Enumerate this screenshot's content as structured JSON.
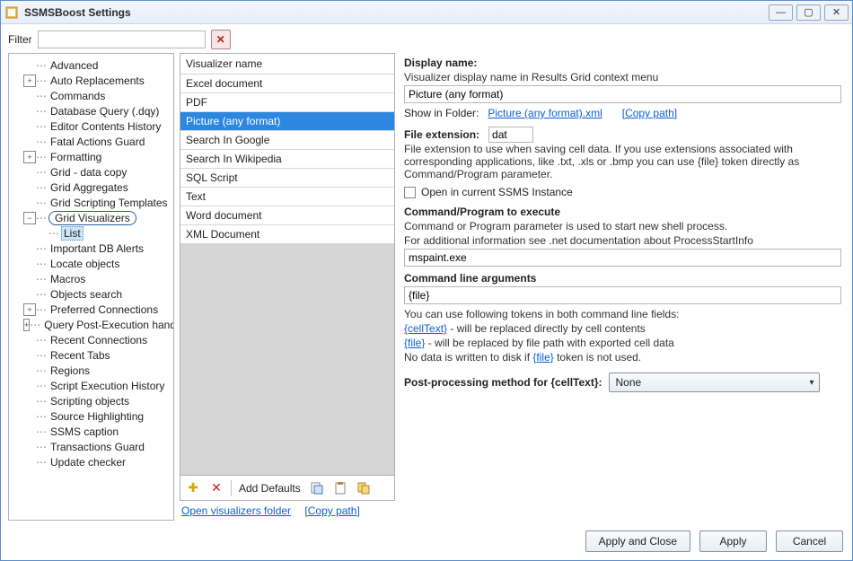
{
  "window": {
    "title": "SSMSBoost Settings"
  },
  "filter": {
    "label": "Filter",
    "value": ""
  },
  "tree": {
    "items": [
      {
        "label": "Advanced",
        "indent": 1
      },
      {
        "label": "Auto Replacements",
        "indent": 1,
        "expand": "plus"
      },
      {
        "label": "Commands",
        "indent": 1
      },
      {
        "label": "Database Query (.dqy)",
        "indent": 1
      },
      {
        "label": "Editor Contents History",
        "indent": 1
      },
      {
        "label": "Fatal Actions Guard",
        "indent": 1
      },
      {
        "label": "Formatting",
        "indent": 1,
        "expand": "plus"
      },
      {
        "label": "Grid - data copy",
        "indent": 1
      },
      {
        "label": "Grid Aggregates",
        "indent": 1
      },
      {
        "label": "Grid Scripting Templates",
        "indent": 1
      },
      {
        "label": "Grid Visualizers",
        "indent": 1,
        "expand": "minus",
        "ring": true
      },
      {
        "label": "List",
        "indent": 2,
        "selected": true
      },
      {
        "label": "Important DB Alerts",
        "indent": 1
      },
      {
        "label": "Locate objects",
        "indent": 1
      },
      {
        "label": "Macros",
        "indent": 1
      },
      {
        "label": "Objects search",
        "indent": 1
      },
      {
        "label": "Preferred Connections",
        "indent": 1,
        "expand": "plus"
      },
      {
        "label": "Query Post-Execution handlers",
        "indent": 1,
        "expand": "plus"
      },
      {
        "label": "Recent Connections",
        "indent": 1
      },
      {
        "label": "Recent Tabs",
        "indent": 1
      },
      {
        "label": "Regions",
        "indent": 1
      },
      {
        "label": "Script Execution History",
        "indent": 1
      },
      {
        "label": "Scripting objects",
        "indent": 1
      },
      {
        "label": "Source Highlighting",
        "indent": 1
      },
      {
        "label": "SSMS caption",
        "indent": 1
      },
      {
        "label": "Transactions Guard",
        "indent": 1
      },
      {
        "label": "Update checker",
        "indent": 1
      }
    ]
  },
  "list": {
    "header": "Visualizer name",
    "items": [
      "Excel document",
      "PDF",
      "Picture (any format)",
      "Search In Google",
      "Search In Wikipedia",
      "SQL Script",
      "Text",
      "Word document",
      "XML Document"
    ],
    "selected_index": 2,
    "toolbar": {
      "add": "add-icon",
      "remove": "remove-icon",
      "defaults_label": "Add Defaults",
      "copy": "copy-icon",
      "paste": "paste-icon",
      "duplicate": "duplicate-icon"
    },
    "links": {
      "open_folder": "Open visualizers folder",
      "copy_path": "[Copy path]"
    }
  },
  "detail": {
    "display_name": {
      "title": "Display name:",
      "desc": "Visualizer display name in Results Grid context menu",
      "value": "Picture (any format)",
      "show_in_label": "Show in Folder:",
      "show_in_link": "Picture (any format).xml",
      "copy_path": "[Copy path]"
    },
    "file_ext": {
      "title": "File extension:",
      "value": "dat",
      "desc": "File extension to use when saving cell data. If you use extensions associated with corresponding applications, like .txt, .xls or .bmp you can use {file} token directly as Command/Program parameter."
    },
    "open_ssms": {
      "label": "Open in current SSMS Instance",
      "checked": false
    },
    "command": {
      "title": "Command/Program to execute",
      "desc1": "Command or Program parameter is used to start new shell process.",
      "desc2": "For additional information see .net documentation about ProcessStartInfo",
      "value": "mspaint.exe"
    },
    "args": {
      "title": "Command line arguments",
      "value": "{file}",
      "tokens_intro": "You can use following tokens in both command line fields:",
      "tok1": "{cellText}",
      "tok1_desc": " - will be replaced directly by cell contents",
      "tok2": "{file}",
      "tok2_desc": " - will be replaced by file path with exported cell data",
      "no_data_pre": "No data is written to disk if ",
      "no_data_post": " token is not used."
    },
    "post": {
      "title": "Post-processing method for {cellText}:",
      "value": "None"
    }
  },
  "footer": {
    "apply_close": "Apply and Close",
    "apply": "Apply",
    "cancel": "Cancel"
  }
}
